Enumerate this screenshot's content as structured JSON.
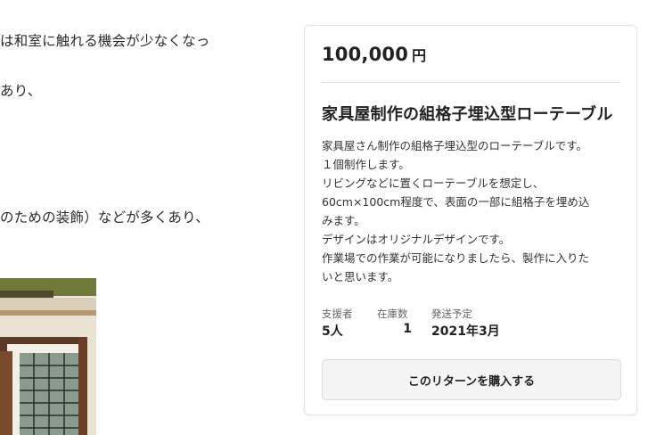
{
  "article": {
    "line1": "は和室に触れる機会が少なくなっ",
    "line2": "あり、",
    "line3": "のための装飾）などが多くあり、"
  },
  "reward": {
    "price": "100,000",
    "currency": "円",
    "title": "家具屋制作の組格子埋込型ローテーブル",
    "description_lines": [
      "家具屋さん制作の組格子埋込型のローテーブルです。",
      "１個制作します。",
      "リビングなどに置くローテーブルを想定し、",
      "60cm×100cm程度で、表面の一部に組格子を埋め込",
      "みます。",
      "デザインはオリジナルデザインです。",
      "作業場での作業が可能になりましたら、製作に入りた",
      "いと思います。"
    ],
    "stats": {
      "backers_label": "支援者",
      "backers_value": "5人",
      "stock_label": "在庫数",
      "stock_value": "1",
      "shipping_label": "発送予定",
      "shipping_value": "2021年3月"
    },
    "button_label": "このリターンを購入する"
  }
}
